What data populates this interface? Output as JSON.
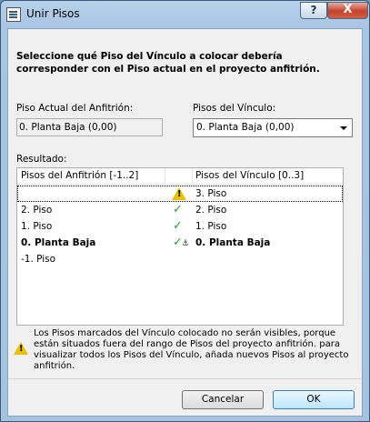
{
  "window": {
    "title": "Unir Pisos",
    "help_label": "?",
    "close_label": "X"
  },
  "instruction": "Seleccione qué Piso del Vínculo a colocar debería corresponder con el Piso actual en el proyecto anfitrión.",
  "host_story": {
    "label": "Piso Actual del Anfitrión:",
    "value": "0. Planta Baja (0,00)"
  },
  "link_story": {
    "label": "Pisos del Vínculo:",
    "selected": "0. Planta Baja (0,00)"
  },
  "result": {
    "label": "Resultado:",
    "columns": [
      "Pisos del Anfitrión [-1..2]",
      "Pisos del Vínculo [0..3]"
    ],
    "rows": [
      {
        "host": "",
        "status": "warning-icon",
        "link": "3. Piso",
        "bold": false
      },
      {
        "host": "2. Piso",
        "status": "check-icon",
        "link": "2. Piso",
        "bold": false
      },
      {
        "host": "1. Piso",
        "status": "check-icon",
        "link": "1. Piso",
        "bold": false
      },
      {
        "host": "0. Planta Baja",
        "status": "check-anchor-icon",
        "link": "0. Planta Baja",
        "bold": true
      },
      {
        "host": "-1. Piso",
        "status": "",
        "link": "",
        "bold": false
      }
    ]
  },
  "warning_text": "Los Pisos marcados del Vínculo colocado no serán visibles, porque están situados fuera del rango de Pisos del proyecto anfitrión. para visualizar todos los Pisos del Vínculo, añada nuevos Pisos al proyecto anfitrión.",
  "buttons": {
    "cancel": "Cancelar",
    "ok": "OK"
  },
  "check_glyph": "✓",
  "colors": {
    "check": "#2aa12a",
    "warning": "#e8c000",
    "close": "#c5432b"
  }
}
